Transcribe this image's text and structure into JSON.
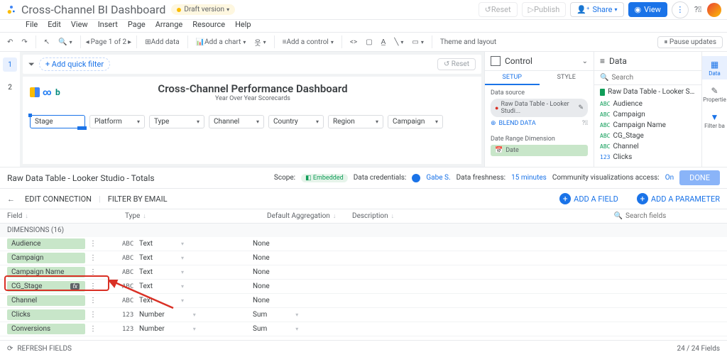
{
  "header": {
    "title": "Cross-Channel BI Dashboard",
    "draft_label": "Draft version",
    "reset": "Reset",
    "publish": "Publish",
    "share": "Share",
    "view": "View"
  },
  "menu": [
    "File",
    "Edit",
    "View",
    "Insert",
    "Page",
    "Arrange",
    "Resource",
    "Help"
  ],
  "toolbar": {
    "page_label": "Page 1 of 2",
    "add_data": "Add data",
    "add_chart": "Add a chart",
    "add_control": "Add a control",
    "theme": "Theme and layout",
    "pause": "Pause updates"
  },
  "canvas": {
    "add_quick_filter": "+ Add quick filter",
    "reset": "Reset",
    "report_title": "Cross-Channel Performance Dashboard",
    "report_subtitle": "Year Over Year Scorecards",
    "dims": [
      "Stage",
      "Platform",
      "Type",
      "Channel",
      "Country",
      "Region",
      "Campaign"
    ]
  },
  "pages": {
    "one": "1",
    "two": "2"
  },
  "control_panel": {
    "title": "Control",
    "setup": "SETUP",
    "style": "STYLE",
    "data_source": "Data source",
    "source_name": "Raw Data Table - Looker Studi...",
    "blend": "BLEND DATA",
    "date_range": "Date Range Dimension",
    "date": "Date"
  },
  "data_panel": {
    "title": "Data",
    "search_placeholder": "Search",
    "source": "Raw Data Table - Looker Studio - Totals",
    "fields": [
      {
        "name": "Audience",
        "t": "ABC"
      },
      {
        "name": "Campaign",
        "t": "ABC"
      },
      {
        "name": "Campaign Name",
        "t": "ABC"
      },
      {
        "name": "CG_Stage",
        "t": "ABC"
      },
      {
        "name": "Channel",
        "t": "ABC"
      },
      {
        "name": "Clicks",
        "t": "123"
      }
    ]
  },
  "rail": {
    "data": "Data",
    "properties": "Propertie",
    "filter": "Filter ba"
  },
  "ds_bar": {
    "title": "Raw Data Table - Looker Studio - Totals",
    "scope_label": "Scope:",
    "scope_value": "Embedded",
    "cred_label": "Data credentials:",
    "cred_user": "Gabe S.",
    "fresh_label": "Data freshness:",
    "fresh_value": "15 minutes",
    "viz_label": "Community visualizations access:",
    "viz_value": "On",
    "done": "DONE"
  },
  "conn_bar": {
    "edit": "EDIT CONNECTION",
    "filter": "FILTER BY EMAIL",
    "add_field": "ADD A FIELD",
    "add_param": "ADD A PARAMETER",
    "search_placeholder": "Search fields"
  },
  "columns": {
    "field": "Field",
    "type": "Type",
    "agg": "Default Aggregation",
    "desc": "Description"
  },
  "dim_header": "DIMENSIONS (16)",
  "rows": [
    {
      "name": "Audience",
      "icon": "ABC",
      "type": "Text",
      "agg": "None",
      "fx": false
    },
    {
      "name": "Campaign",
      "icon": "ABC",
      "type": "Text",
      "agg": "None",
      "fx": false
    },
    {
      "name": "Campaign Name",
      "icon": "ABC",
      "type": "Text",
      "agg": "None",
      "fx": false
    },
    {
      "name": "CG_Stage",
      "icon": "ABC",
      "type": "Text",
      "agg": "None",
      "fx": true
    },
    {
      "name": "Channel",
      "icon": "ABC",
      "type": "Text",
      "agg": "None",
      "fx": false
    },
    {
      "name": "Clicks",
      "icon": "123",
      "type": "Number",
      "agg": "Sum",
      "fx": false
    },
    {
      "name": "Conversions",
      "icon": "123",
      "type": "Number",
      "agg": "Sum",
      "fx": false
    }
  ],
  "footer": {
    "refresh": "REFRESH FIELDS",
    "count": "24 / 24 Fields"
  }
}
